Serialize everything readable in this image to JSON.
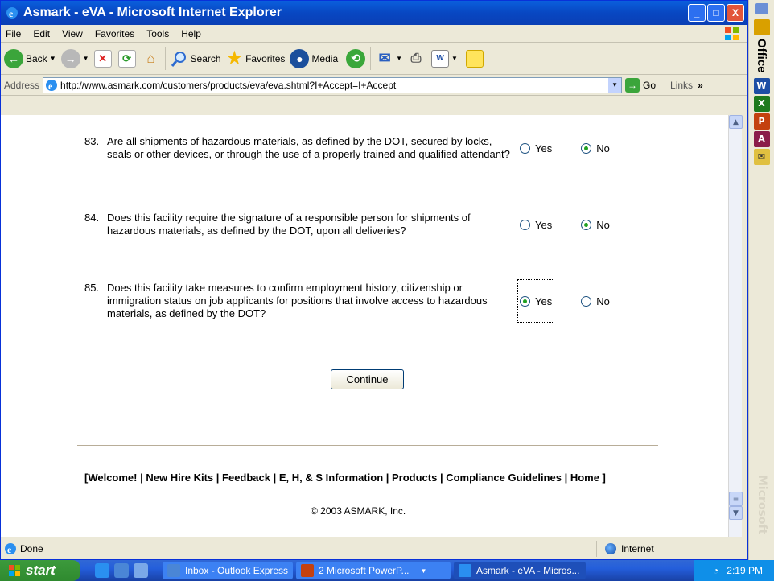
{
  "window": {
    "title": "Asmark - eVA - Microsoft Internet Explorer",
    "controls": {
      "minimize": "_",
      "maximize": "□",
      "close": "X"
    }
  },
  "menu": [
    "File",
    "Edit",
    "View",
    "Favorites",
    "Tools",
    "Help"
  ],
  "toolbar": {
    "back_label": "Back",
    "search_label": "Search",
    "favorites_label": "Favorites",
    "media_label": "Media"
  },
  "address": {
    "label": "Address",
    "url": "http://www.asmark.com/customers/products/eva/eva.shtml?I+Accept=I+Accept",
    "go_label": "Go",
    "links_label": "Links"
  },
  "questions": [
    {
      "number": "83.",
      "text": "Are all shipments of hazardous materials, as defined by the DOT, secured by locks, seals or other devices, or through the use of a properly trained and qualified attendant?",
      "yes_label": "Yes",
      "no_label": "No",
      "selected": "No"
    },
    {
      "number": "84.",
      "text": "Does this facility require the signature of a responsible person for shipments of hazardous materials, as defined by the DOT, upon all deliveries?",
      "yes_label": "Yes",
      "no_label": "No",
      "selected": "No"
    },
    {
      "number": "85.",
      "text": "Does this facility take measures to confirm employment history, citizenship or immigration status on job applicants for positions that involve access to hazardous materials, as defined by the DOT?",
      "yes_label": "Yes",
      "no_label": "No",
      "selected": "Yes"
    }
  ],
  "continue_label": "Continue",
  "footer": {
    "links": "[Welcome! | New Hire Kits | Feedback | E, H, & S Information | Products | Compliance Guidelines | Home ]",
    "copyright": "© 2003 ASMARK, Inc."
  },
  "status": {
    "text": "Done",
    "zone": "Internet"
  },
  "office_bar": {
    "label": "Office",
    "faint_label": "Microsoft"
  },
  "taskbar": {
    "start_label": "start",
    "tasks": [
      {
        "label": "Inbox - Outlook Express"
      },
      {
        "label": "2 Microsoft PowerP..."
      },
      {
        "label": "Asmark - eVA - Micros..."
      }
    ],
    "clock": "2:19 PM"
  },
  "colors": {
    "titlebar": "#0a5fdd",
    "taskbar": "#245edb",
    "start": "#2f8a2f",
    "radio_selected": "#21a121"
  }
}
